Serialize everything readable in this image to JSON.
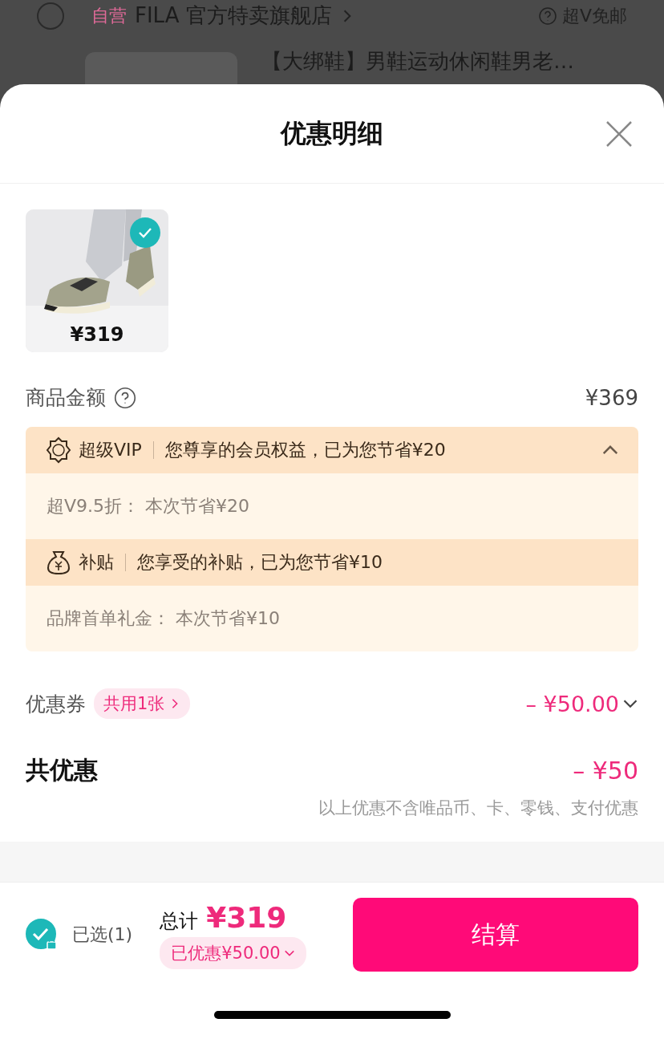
{
  "background": {
    "store": {
      "selected": false,
      "badge": "自营",
      "name": "FILA 官方特卖旗舰店",
      "shipping": "超V免邮"
    },
    "product_title": "【大绑鞋】男鞋运动休闲鞋男老…"
  },
  "sheet": {
    "title": "优惠明细"
  },
  "items": [
    {
      "kind": "picture",
      "price": "¥319",
      "selected": true
    }
  ],
  "goods_amount": {
    "label": "商品金额",
    "value": "¥369"
  },
  "benefits": [
    {
      "kind": "vip",
      "name": "超级VIP",
      "summary": "您尊享的会员权益，已为您节省¥20",
      "expanded": true,
      "details": [
        {
          "label": "超V9.5折：",
          "value": "本次节省¥20"
        }
      ]
    },
    {
      "kind": "subsidy",
      "name": "补贴",
      "summary": "您享受的补贴，已为您节省¥10",
      "expanded": true,
      "details": [
        {
          "label": "品牌首单礼金：",
          "value": "本次节省¥10"
        }
      ]
    }
  ],
  "coupon": {
    "label": "优惠券",
    "tag": "共用1张",
    "value": "– ¥50.00"
  },
  "total_discount": {
    "label": "共优惠",
    "value": "– ¥50",
    "note": "以上优惠不含唯品币、卡、零钱、支付优惠"
  },
  "footer": {
    "selected": true,
    "selected_label": "已选(1)",
    "total_label": "总计",
    "total": "¥319",
    "discount": "已优惠¥50.00",
    "checkout": "结算"
  }
}
